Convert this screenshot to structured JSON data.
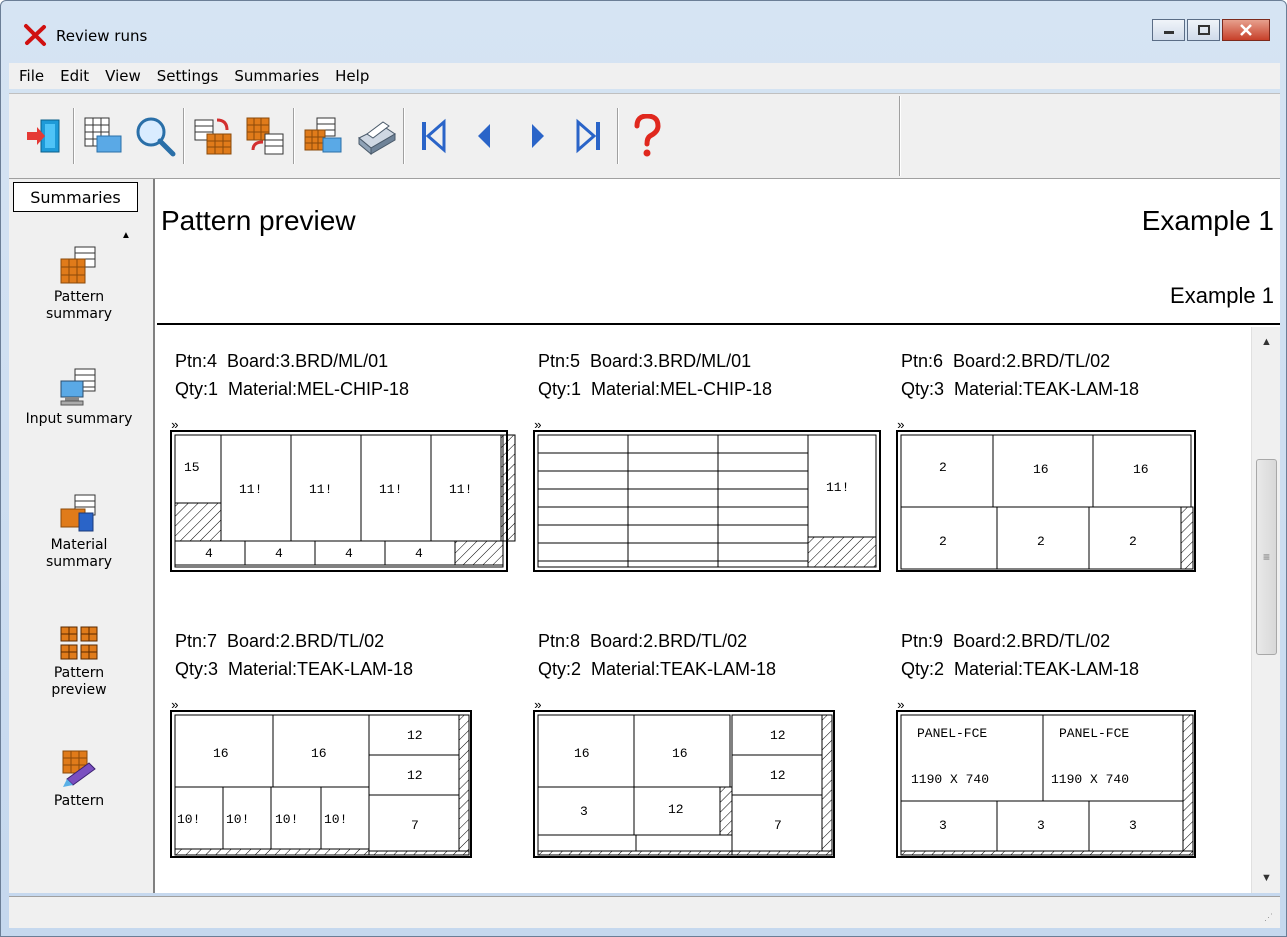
{
  "window": {
    "title": "Review runs"
  },
  "menu": [
    "File",
    "Edit",
    "View",
    "Settings",
    "Summaries",
    "Help"
  ],
  "toolbar": {
    "buttons": [
      {
        "icon": "exit-door-icon"
      },
      {
        "icon": "table-view-icon"
      },
      {
        "icon": "magnifier-icon"
      },
      {
        "icon": "pattern-swap-icon"
      },
      {
        "icon": "pattern-undo-icon"
      },
      {
        "icon": "print-preview-icon"
      },
      {
        "icon": "printer-icon"
      },
      {
        "icon": "first-page-icon"
      },
      {
        "icon": "previous-page-icon"
      },
      {
        "icon": "next-page-icon"
      },
      {
        "icon": "last-page-icon"
      },
      {
        "icon": "help-icon"
      }
    ]
  },
  "sidebar": {
    "tab_label": "Summaries",
    "items": [
      {
        "icon": "pattern-summary-icon",
        "label_1": "Pattern",
        "label_2": "summary"
      },
      {
        "icon": "input-summary-icon",
        "label_1": "Input summary",
        "label_2": ""
      },
      {
        "icon": "material-summary-icon",
        "label_1": "Material",
        "label_2": "summary"
      },
      {
        "icon": "pattern-preview-icon",
        "label_1": "Pattern",
        "label_2": "preview"
      },
      {
        "icon": "pattern-icon",
        "label_1": "Pattern",
        "label_2": ""
      }
    ]
  },
  "header": {
    "title": "Pattern preview",
    "report_name": "Example 1",
    "report_sub": "Example 1"
  },
  "patterns": [
    {
      "line1": "Ptn:4  Board:3.BRD/ML/01",
      "line2": "Qty:1  Material:MEL-CHIP-18"
    },
    {
      "line1": "Ptn:5  Board:3.BRD/ML/01",
      "line2": "Qty:1  Material:MEL-CHIP-18"
    },
    {
      "line1": "Ptn:6  Board:2.BRD/TL/02",
      "line2": "Qty:3  Material:TEAK-LAM-18"
    },
    {
      "line1": "Ptn:7  Board:2.BRD/TL/02",
      "line2": "Qty:3  Material:TEAK-LAM-18"
    },
    {
      "line1": "Ptn:8  Board:2.BRD/TL/02",
      "line2": "Qty:2  Material:TEAK-LAM-18"
    },
    {
      "line1": "Ptn:9  Board:2.BRD/TL/02",
      "line2": "Qty:2  Material:TEAK-LAM-18"
    }
  ],
  "layouts": {
    "ptn4": {
      "top": [
        "15",
        "11!",
        "11!",
        "11!",
        "11!"
      ],
      "bottom": [
        "4",
        "4",
        "4",
        "4"
      ]
    },
    "ptn5": {
      "right": "11!"
    },
    "ptn6": {
      "top": [
        "2",
        "16",
        "16"
      ],
      "bottom": [
        "2",
        "2",
        "2"
      ]
    },
    "ptn7": {
      "top": [
        "16",
        "16"
      ],
      "bottom": [
        "10!",
        "10!",
        "10!",
        "10!"
      ],
      "right": [
        "12",
        "12",
        "7"
      ]
    },
    "ptn8": {
      "top": [
        "16",
        "16"
      ],
      "middle": [
        "3",
        "12"
      ],
      "right": [
        "12",
        "12",
        "7"
      ]
    },
    "ptn9": {
      "top_a": [
        "PANEL-FCE",
        "PANEL-FCE"
      ],
      "top_b": [
        "1190 X 740",
        "1190 X 740"
      ],
      "bottom": [
        "3",
        "3",
        "3"
      ]
    }
  },
  "colors": {
    "title_bar": "#c5d8ee",
    "close_button": "#c7402a",
    "nav_arrow": "#2a64c8",
    "help": "#e0281e"
  }
}
